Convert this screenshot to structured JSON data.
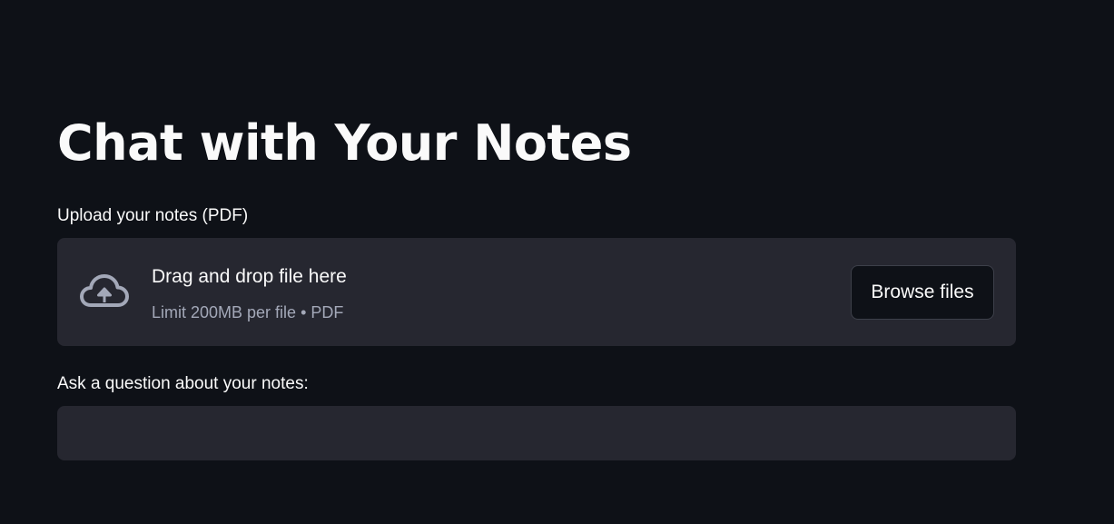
{
  "page": {
    "title": "Chat with Your Notes"
  },
  "uploader": {
    "label": "Upload your notes (PDF)",
    "drop_title": "Drag and drop file here",
    "drop_hint": "Limit 200MB per file • PDF",
    "browse_label": "Browse files",
    "icon": "cloud-upload-icon"
  },
  "question": {
    "label": "Ask a question about your notes:",
    "value": "",
    "placeholder": ""
  },
  "colors": {
    "background": "#0e1117",
    "surface": "#262730",
    "text": "#fafafa",
    "muted_text": "#a3a8b8",
    "icon": "#a3a8b8"
  }
}
